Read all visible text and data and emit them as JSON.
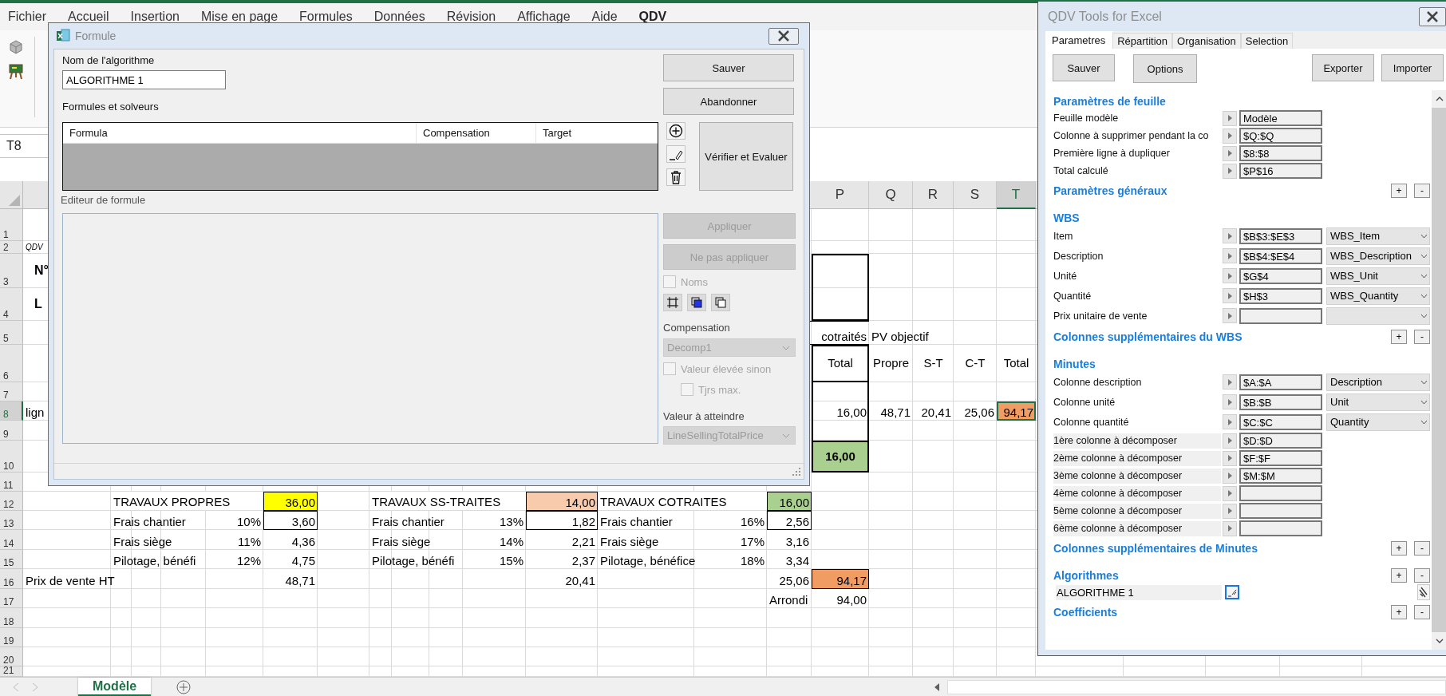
{
  "excel": {
    "menu": [
      {
        "label": "Fichier",
        "selected": false
      },
      {
        "label": "Accueil",
        "selected": false
      },
      {
        "label": "Insertion",
        "selected": false
      },
      {
        "label": "Mise en page",
        "selected": false
      },
      {
        "label": "Formules",
        "selected": false
      },
      {
        "label": "Données",
        "selected": false
      },
      {
        "label": "Révision",
        "selected": false
      },
      {
        "label": "Affichage",
        "selected": false
      },
      {
        "label": "Aide",
        "selected": false
      },
      {
        "label": "QDV",
        "selected": true
      }
    ],
    "name_box": "T8",
    "column_headers": [
      {
        "label": "P",
        "selected": false
      },
      {
        "label": "Q",
        "selected": false
      },
      {
        "label": "R",
        "selected": false
      },
      {
        "label": "S",
        "selected": false
      },
      {
        "label": "T",
        "selected": true
      }
    ],
    "row_numbers": [
      {
        "label": "1",
        "selected": false
      },
      {
        "label": "2",
        "selected": false
      },
      {
        "label": "3",
        "selected": false
      },
      {
        "label": "4",
        "selected": false
      },
      {
        "label": "5",
        "selected": false
      },
      {
        "label": "6",
        "selected": false
      },
      {
        "label": "7",
        "selected": false
      },
      {
        "label": "8",
        "selected": true
      },
      {
        "label": "9",
        "selected": false
      },
      {
        "label": "10",
        "selected": false
      },
      {
        "label": "11",
        "selected": false
      },
      {
        "label": "12",
        "selected": false
      },
      {
        "label": "13",
        "selected": false
      },
      {
        "label": "14",
        "selected": false
      },
      {
        "label": "15",
        "selected": false
      },
      {
        "label": "16",
        "selected": false
      },
      {
        "label": "17",
        "selected": false
      },
      {
        "label": "18",
        "selected": false
      },
      {
        "label": "19",
        "selected": false
      },
      {
        "label": "20",
        "selected": false
      },
      {
        "label": "21",
        "selected": false
      }
    ],
    "left_fragments": [
      "QDV",
      "N°",
      "L",
      "lign"
    ],
    "results": {
      "group_header": "cotraités",
      "objective_header": "PV objectif",
      "titles": [
        "Total",
        "Propre",
        "S-T",
        "C-T",
        "Total"
      ],
      "values": [
        {
          "text": "16,00",
          "selected": false
        },
        {
          "text": "48,71",
          "selected": false
        },
        {
          "text": "20,41",
          "selected": false
        },
        {
          "text": "25,06",
          "selected": false
        },
        {
          "text": "94,17",
          "selected": true,
          "color": "#f19c63"
        }
      ],
      "total": {
        "text": "16,00",
        "color": "#a9d08e"
      }
    },
    "groups": [
      {
        "title": "TRAVAUX PROPRES",
        "total": "36,00",
        "color": "#ffff00",
        "lines": [
          {
            "label": "Frais chantier",
            "rate": "10%",
            "value": "3,60"
          },
          {
            "label": "Frais siège",
            "rate": "11%",
            "value": "4,36"
          },
          {
            "label": "Pilotage, bénéfi",
            "rate": "12%",
            "value": "4,75"
          }
        ],
        "subtotal": "48,71"
      },
      {
        "title": "TRAVAUX SS-TRAITES",
        "total": "14,00",
        "color": "#f8cbad",
        "lines": [
          {
            "label": "Frais chantier",
            "rate": "13%",
            "value": "1,82"
          },
          {
            "label": "Frais siège",
            "rate": "14%",
            "value": "2,21"
          },
          {
            "label": "Pilotage, bénéfi",
            "rate": "15%",
            "value": "2,37"
          }
        ],
        "subtotal": "20,41"
      },
      {
        "title": "TRAVAUX COTRAITES",
        "total": "16,00",
        "color": "#a9d08e",
        "lines": [
          {
            "label": "Frais chantier",
            "rate": "16%",
            "value": "2,56"
          },
          {
            "label": "Frais siège",
            "rate": "17%",
            "value": "3,16"
          },
          {
            "label": "Pilotage, bénéfice",
            "rate": "18%",
            "value": "3,34"
          }
        ],
        "subtotal": "25,06"
      }
    ],
    "sale_price_label": "Prix de vente HT",
    "grand_total": {
      "text": "94,17",
      "color": "#f19c63"
    },
    "rounding": {
      "label": "Arrondi",
      "value": "94,00"
    },
    "sheet_tabs": [
      {
        "label": "Modèle",
        "selected": true
      }
    ]
  },
  "formula_dialog": {
    "title": "Formule",
    "name_label": "Nom de l'algorithme",
    "name_value": "ALGORITHME 1",
    "save": "Sauver",
    "cancel": "Abandonner",
    "list_label": "Formules et solveurs",
    "columns": [
      "Formula",
      "Compensation",
      "Target"
    ],
    "evaluate": "Vérifier et Evaluer",
    "editor_label": "Editeur de formule",
    "apply": {
      "label": "Appliquer",
      "disabled": true
    },
    "discard": {
      "label": "Ne pas appliquer",
      "disabled": true
    },
    "names": {
      "label": "Noms",
      "checked": false,
      "disabled": true
    },
    "compensation_label": "Compensation",
    "compensation": {
      "value": "Decomp1",
      "disabled": true
    },
    "high_value": {
      "label": "Valeur élevée sinon",
      "checked": false,
      "disabled": true
    },
    "always_max": {
      "label": "Tjrs max.",
      "checked": false,
      "disabled": true
    },
    "target_label": "Valeur à atteindre",
    "target": {
      "value": "LineSellingTotalPrice",
      "disabled": true
    }
  },
  "tools_panel": {
    "title": "QDV Tools for Excel",
    "tabs": [
      {
        "label": "Parametres",
        "selected": true
      },
      {
        "label": "Répartition",
        "selected": false
      },
      {
        "label": "Organisation",
        "selected": false
      },
      {
        "label": "Selection",
        "selected": false
      }
    ],
    "buttons": [
      "Sauver",
      "Options",
      "Exporter",
      "Importer"
    ],
    "sections": [
      {
        "title": "Paramètres de feuille",
        "rows": [
          {
            "kind": "field",
            "label": "Feuille modèle",
            "value": "Modèle"
          },
          {
            "kind": "field",
            "label": "Colonne à supprimer pendant la co",
            "value": "$Q:$Q"
          },
          {
            "kind": "field",
            "label": "Première ligne à dupliquer",
            "value": "$8:$8"
          },
          {
            "kind": "field",
            "label": "Total calculé",
            "value": "$P$16"
          }
        ]
      },
      {
        "title": "Paramètres généraux",
        "controls": [
          "+",
          "-"
        ]
      },
      {
        "title": "WBS",
        "rows": [
          {
            "kind": "combo",
            "label": "Item",
            "value": "$B$3:$E$3",
            "choice": "WBS_Item"
          },
          {
            "kind": "combo",
            "label": "Description",
            "value": "$B$4:$E$4",
            "choice": "WBS_Description"
          },
          {
            "kind": "combo",
            "label": "Unité",
            "value": "$G$4",
            "choice": "WBS_Unit"
          },
          {
            "kind": "combo",
            "label": "Quantité",
            "value": "$H$3",
            "choice": "WBS_Quantity"
          },
          {
            "kind": "combo",
            "label": "Prix unitaire de vente"
          }
        ]
      },
      {
        "title": "Colonnes supplémentaires du WBS",
        "controls": [
          "+",
          "-"
        ]
      },
      {
        "title": "Minutes",
        "rows": [
          {
            "kind": "combo",
            "label": "Colonne description",
            "value": "$A:$A",
            "choice": "Description"
          },
          {
            "kind": "combo",
            "label": "Colonne unité",
            "value": "$B:$B",
            "choice": "Unit"
          },
          {
            "kind": "combo",
            "label": "Colonne quantité",
            "value": "$C:$C",
            "choice": "Quantity"
          },
          {
            "kind": "split",
            "label": "1ère colonne à décomposer",
            "value": "$D:$D"
          },
          {
            "kind": "split",
            "label": "2ème colonne à décomposer",
            "value": "$F:$F"
          },
          {
            "kind": "split",
            "label": "3ème colonne à décomposer",
            "value": "$M:$M"
          },
          {
            "kind": "split",
            "label": "4ème colonne à décomposer"
          },
          {
            "kind": "split",
            "label": "5ème colonne à décomposer"
          },
          {
            "kind": "split",
            "label": "6ème colonne à décomposer"
          }
        ]
      },
      {
        "title": "Colonnes supplémentaires de Minutes",
        "controls": [
          "+",
          "-"
        ]
      },
      {
        "title": "Algorithmes",
        "controls": [
          "+",
          "-"
        ],
        "items": [
          "ALGORITHME 1"
        ]
      },
      {
        "title": "Coefficients",
        "controls": [
          "+",
          "-"
        ]
      }
    ]
  }
}
